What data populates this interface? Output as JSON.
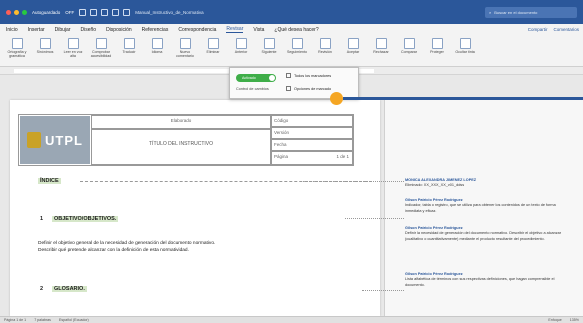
{
  "titlebar": {
    "autosave_label": "Autoguardado",
    "autosave_state": "OFF",
    "document_name": "Manual_Instructivo_de_Normativa",
    "search_placeholder": "Buscar en el documento",
    "colors": {
      "bar": "#2b579a",
      "close": "#ff5f57",
      "min": "#febc2e",
      "max": "#28c840"
    }
  },
  "tabs": {
    "items": [
      "Inicio",
      "Insertar",
      "Dibujar",
      "Diseño",
      "Disposición",
      "Referencias",
      "Correspondencia",
      "Revisar",
      "Vista",
      "¿Qué desea hacer?"
    ],
    "active": "Revisar",
    "share_label": "Compartir",
    "comments_label": "Comentarios"
  },
  "ribbon": {
    "buttons": [
      {
        "label": "Ortografía y gramática",
        "icon": "spellcheck-icon"
      },
      {
        "label": "Sinónimos",
        "icon": "thesaurus-icon"
      },
      {
        "label": "Leer en voz alta",
        "icon": "read-aloud-icon"
      },
      {
        "label": "Comprobar accesibilidad",
        "icon": "accessibility-icon"
      },
      {
        "label": "Traducir",
        "icon": "translate-icon"
      },
      {
        "label": "Idioma",
        "icon": "language-icon"
      },
      {
        "label": "Nuevo comentario",
        "icon": "new-comment-icon"
      },
      {
        "label": "Eliminar",
        "icon": "delete-comment-icon"
      },
      {
        "label": "Anterior",
        "icon": "previous-comment-icon"
      },
      {
        "label": "Siguiente",
        "icon": "next-comment-icon"
      },
      {
        "label": "Seguimiento",
        "icon": "track-changes-icon"
      },
      {
        "label": "Revisión",
        "icon": "review-pane-icon"
      },
      {
        "label": "Aceptar",
        "icon": "accept-icon"
      },
      {
        "label": "Rechazar",
        "icon": "reject-icon"
      },
      {
        "label": "Comparar",
        "icon": "compare-icon"
      },
      {
        "label": "Proteger",
        "icon": "protect-icon"
      },
      {
        "label": "Ocultar tinta",
        "icon": "hide-ink-icon"
      }
    ]
  },
  "track_menu": {
    "toggle_label": "Activado",
    "toggle_on": true,
    "side_label": "Control de cambios",
    "items": [
      "Todos los marcadores",
      "Opciones de marcado"
    ],
    "accent": "#f5a623"
  },
  "document": {
    "header": {
      "logo_text": "UTPL",
      "role_label": "Elaborado",
      "title": "TÍTULO DEL INSTRUCTIVO",
      "fields": [
        {
          "label": "Código",
          "value": ""
        },
        {
          "label": "Versión",
          "value": ""
        },
        {
          "label": "Fecha",
          "value": ""
        },
        {
          "label": "Página",
          "value": "1 de 1"
        }
      ]
    },
    "index_heading": "ÍNDICE",
    "sections": [
      {
        "number": "1",
        "title": "OBJETIVO/OBJETIVOS."
      },
      {
        "number": "2",
        "title": "GLOSARIO."
      }
    ],
    "paragraph": [
      "Definir el objetivo general de la necesidad de generación del documento normativo.",
      "Describir qué pretende alcanzar con la definición de esta normatividad."
    ]
  },
  "comments": [
    {
      "author": "MONICA ALEXANDRA JIMENEZ LOPEZ",
      "text": "Eliminado: XX_XXX_XX_v01_ddss"
    },
    {
      "author": "Gilson Patricio Pérez Rodríguez",
      "text": "Indicador, tabla o registro, que se utiliza para obtener los contenidos de un texto de forma inmediata y eficaz."
    },
    {
      "author": "Gilson Patricio Pérez Rodríguez",
      "text": "Definir la necesidad de generación del documento normativo. Describir el objetivo a alcanzar (cualitativo o cuantitativamente) mediante el producto resultante del procedimiento."
    },
    {
      "author": "Gilson Patricio Pérez Rodríguez",
      "text": "Lista alfabética de términos con sus respectivas definiciones, que hagan comprensible el documento."
    }
  ],
  "statusbar": {
    "page": "Página 1 de 1",
    "words": "7 palabras",
    "language": "Español (Ecuador)",
    "view_label": "Enfoque",
    "zoom": "135%"
  }
}
